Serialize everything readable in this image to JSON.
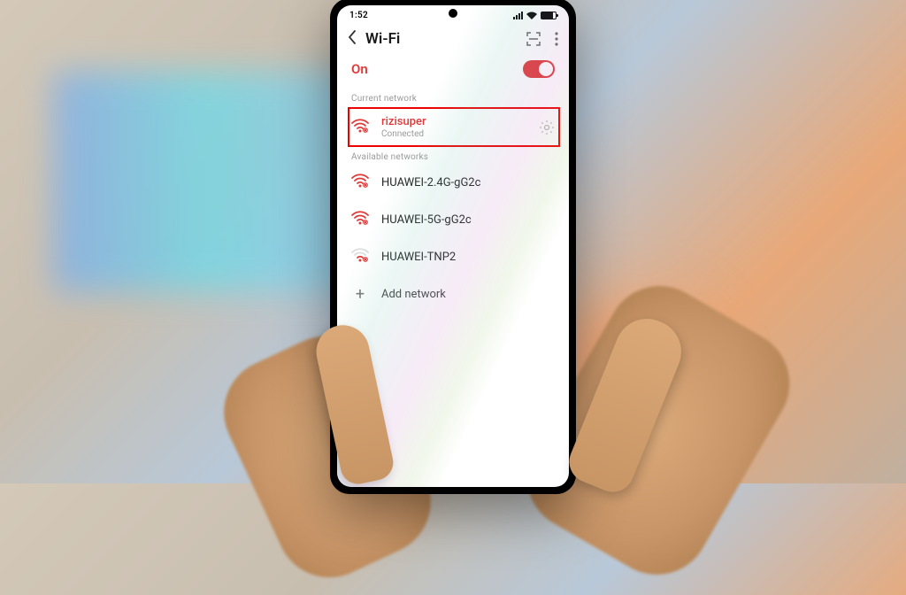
{
  "status_bar": {
    "time": "1:52",
    "battery_pct": "79"
  },
  "header": {
    "title": "Wi-Fi"
  },
  "wifi_toggle": {
    "label": "On",
    "state": true
  },
  "sections": {
    "current_label": "Current network",
    "available_label": "Available networks"
  },
  "current_network": {
    "ssid": "rizisuper",
    "status": "Connected"
  },
  "available": [
    {
      "ssid": "HUAWEI-2.4G-gG2c"
    },
    {
      "ssid": "HUAWEI-5G-gG2c"
    },
    {
      "ssid": "HUAWEI-TNP2"
    }
  ],
  "add_network": {
    "label": "Add network"
  },
  "colors": {
    "accent": "#e13a3a",
    "highlight": "#e00000"
  }
}
